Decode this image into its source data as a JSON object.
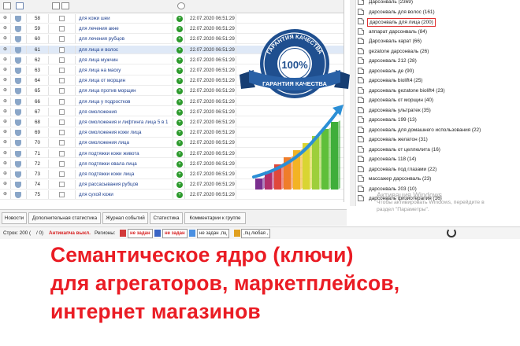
{
  "table": {
    "rows": [
      {
        "num": "58",
        "keyword": "для кожи шеи",
        "date": "22.07.2020 06:51:29"
      },
      {
        "num": "59",
        "keyword": "для лечения акне",
        "date": "22.07.2020 06:51:29"
      },
      {
        "num": "60",
        "keyword": "для лечения рубцов",
        "date": "22.07.2020 06:51:29"
      },
      {
        "num": "61",
        "keyword": "для лица и волос",
        "date": "22.07.2020 06:51:29"
      },
      {
        "num": "62",
        "keyword": "для лица мужчин",
        "date": "22.07.2020 06:51:29"
      },
      {
        "num": "63",
        "keyword": "для лица на маску",
        "date": "22.07.2020 06:51:29"
      },
      {
        "num": "64",
        "keyword": "для лица от морщин",
        "date": "22.07.2020 06:51:29"
      },
      {
        "num": "65",
        "keyword": "для лица против морщин",
        "date": "22.07.2020 06:51:29"
      },
      {
        "num": "66",
        "keyword": "для лица у подростков",
        "date": "22.07.2020 06:51:29"
      },
      {
        "num": "67",
        "keyword": "для омоложения",
        "date": "22.07.2020 06:51:29"
      },
      {
        "num": "68",
        "keyword": "для омоложения и лифтинга лица 5 в 1",
        "date": "22.07.2020 06:51:29"
      },
      {
        "num": "69",
        "keyword": "для омоложения кожи лица",
        "date": "22.07.2020 06:51:29"
      },
      {
        "num": "70",
        "keyword": "для омоложения лица",
        "date": "22.07.2020 06:51:29"
      },
      {
        "num": "71",
        "keyword": "для подтяжки кожи живота",
        "date": "22.07.2020 06:51:29"
      },
      {
        "num": "72",
        "keyword": "для подтяжки овала лица",
        "date": "22.07.2020 06:51:29"
      },
      {
        "num": "73",
        "keyword": "для подтяжки кожи лица",
        "date": "22.07.2020 06:51:29"
      },
      {
        "num": "74",
        "keyword": "для рассасывания рубцов",
        "date": "22.07.2020 06:51:29"
      },
      {
        "num": "75",
        "keyword": "для сухой кожи",
        "date": "22.07.2020 06:51:29"
      }
    ]
  },
  "badge": {
    "top_text": "ГАРАНТИЯ КАЧЕСТВА",
    "center": "100%",
    "ribbon": "ГАРАНТИЯ КАЧЕСТВА"
  },
  "tree": {
    "items": [
      {
        "label": "Дарсонваль (2369)"
      },
      {
        "label": "дарсонваль для волос (161)"
      },
      {
        "label": "дарсонваль для лица (200)",
        "highlight": true
      },
      {
        "label": "аппарат дарсонваль (84)"
      },
      {
        "label": "Дарсонваль карат (66)"
      },
      {
        "label": "gezatone дарсонваль (26)"
      },
      {
        "label": "дарсонваль 212 (28)"
      },
      {
        "label": "дарсонваль де (90)"
      },
      {
        "label": "дарсонваль biolift4 (25)"
      },
      {
        "label": "дарсонваль gezatone biolift4 (23)"
      },
      {
        "label": "дарсонваль от морщин (40)"
      },
      {
        "label": "дарсонваль ультратек (35)"
      },
      {
        "label": "дарсонваль 199 (13)"
      },
      {
        "label": "дарсонваль для домашнего использования (22)"
      },
      {
        "label": "дарсонваль желатон (31)"
      },
      {
        "label": "дарсонваль от целлюлита (16)"
      },
      {
        "label": "дарсонваль 118 (14)"
      },
      {
        "label": "дарсонваль под глазами (22)"
      },
      {
        "label": "массажер дарсонваль (23)"
      },
      {
        "label": "дарсонваль 203 (10)"
      },
      {
        "label": "дарсонваль физиотерапия (16)"
      }
    ]
  },
  "watermark": {
    "title": "Активация Windows",
    "line1": "Чтобы активировать Windows, перейдите в",
    "line2": "раздел \"Параметры\"."
  },
  "tabs": [
    {
      "label": "Новости"
    },
    {
      "label": "Дополнительная статистика"
    },
    {
      "label": "Журнал событий"
    },
    {
      "label": "Статистика"
    },
    {
      "label": "Комментарии к группе"
    }
  ],
  "status": {
    "rows": "Строк: 200 (",
    "rows_tail": "/ 0)",
    "anticaptcha": "Антикапча выкл.",
    "regions": "Регионы:",
    "not_set_1": "не задан",
    "not_set_2": "не задан",
    "not_set_3": "не задан ,пц",
    "words": ",пц любая ,"
  },
  "headline": {
    "line1": "Семантическое ядро (ключи)",
    "line2": "для агрегаторов, маркетплейсов,",
    "line3": "интернет магазинов"
  },
  "colors": {
    "headline": "#ea1c24",
    "badge_blue": "#1f4f8f",
    "accent_green": "#2c9a2c"
  }
}
